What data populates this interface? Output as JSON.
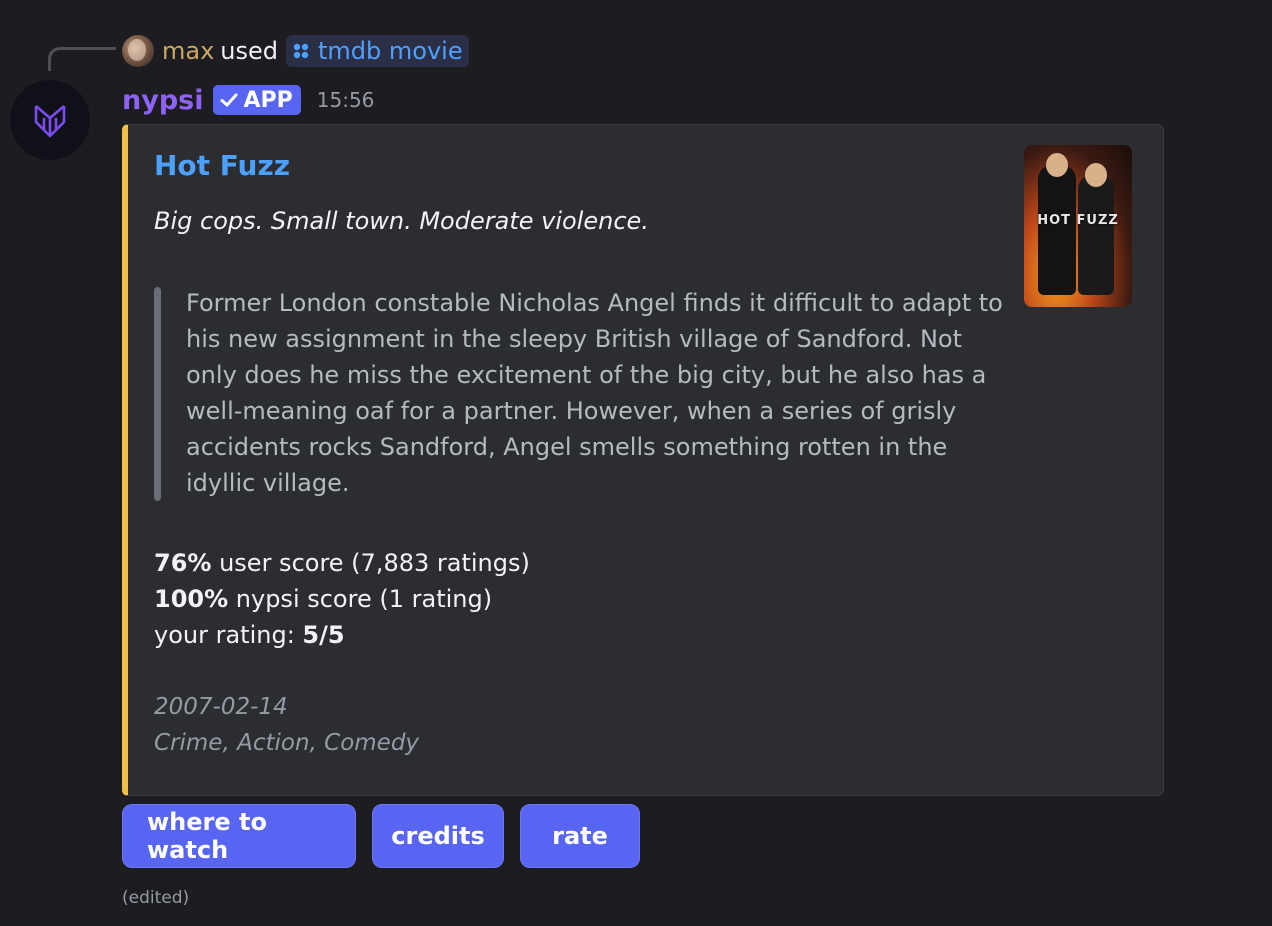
{
  "command": {
    "user": "max",
    "used_text": "used",
    "command_name": "tmdb movie"
  },
  "message": {
    "bot_name": "nypsi",
    "badge": "APP",
    "timestamp": "15:56",
    "edited": "(edited)"
  },
  "embed": {
    "accent_color": "#f0c04a",
    "title": "Hot Fuzz",
    "tagline": "Big cops. Small town. Moderate violence.",
    "overview": "Former London constable Nicholas Angel finds it difficult to adapt to his new assignment in the sleepy British village of Sandford. Not only does he miss the excitement of the big city, but he also has a well-meaning oaf for a partner. However, when a series of grisly accidents rocks Sandford, Angel smells something rotten in the idyllic village.",
    "user_score": {
      "value": "76%",
      "text": " user score (7,883 ratings)"
    },
    "nypsi_score": {
      "value": "100%",
      "text": " nypsi score (1 rating)"
    },
    "your_rating": {
      "label": "your rating: ",
      "value": "5/5"
    },
    "release_date": "2007-02-14",
    "genres": "Crime, Action, Comedy",
    "poster_text": "HOT FUZZ"
  },
  "buttons": [
    {
      "label": "where to watch"
    },
    {
      "label": "credits"
    },
    {
      "label": "rate"
    }
  ],
  "colors": {
    "background": "#1c1c21",
    "embed_bg": "#2b2d31",
    "link": "#4ea0ff",
    "bot_name": "#8d63f7",
    "button": "#5865f2"
  }
}
